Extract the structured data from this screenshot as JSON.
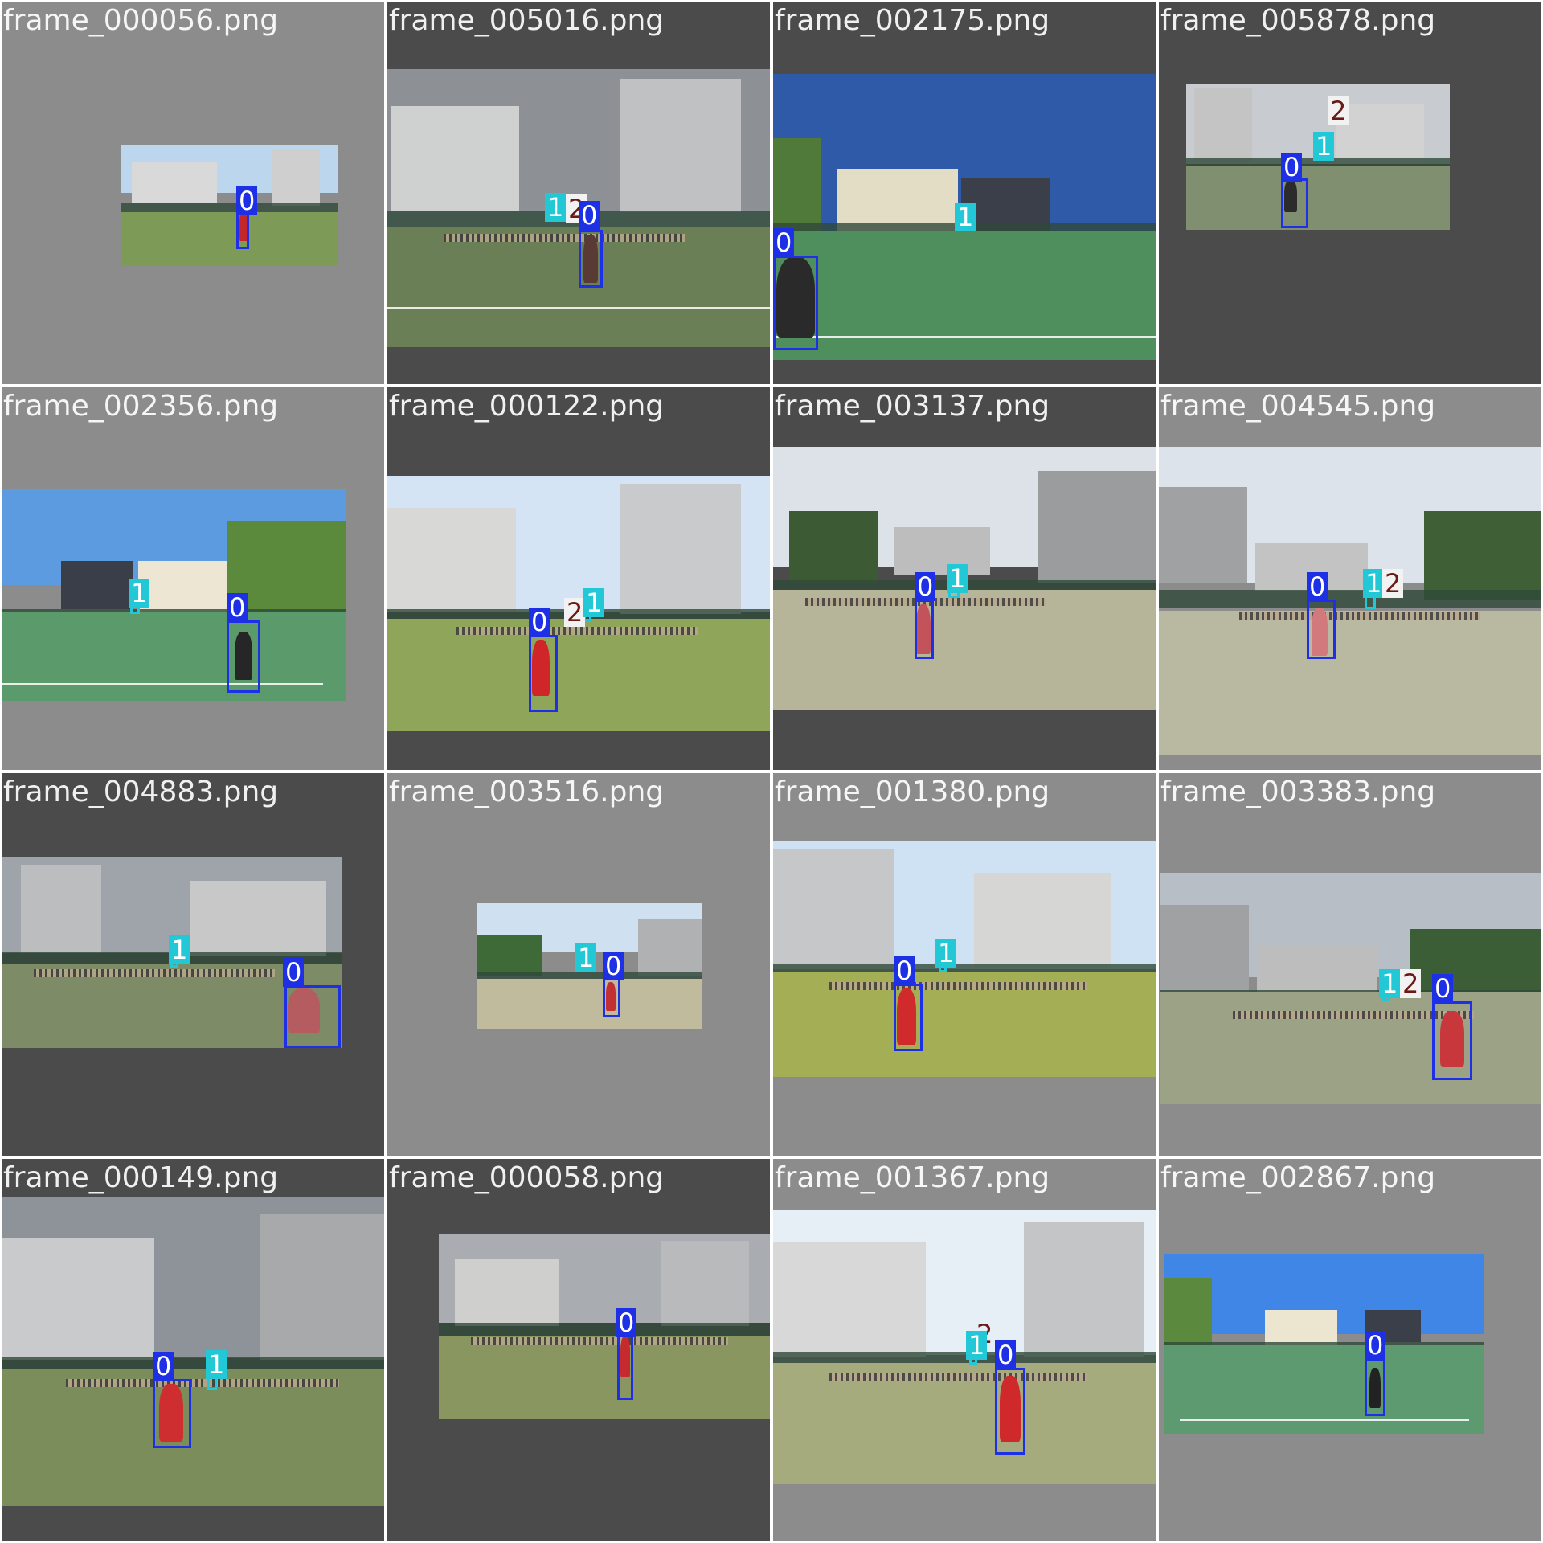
{
  "colors": {
    "tile_bg_light": "#8c8c8c",
    "tile_bg_dark": "#4b4b4b",
    "class_0": "#1e30e6",
    "class_1": "#22c8d6",
    "class_2": "#f2f2f2",
    "class_2_text": "#6a1a14"
  },
  "tiles": [
    {
      "filename": "frame_000056.png",
      "bg": "light",
      "sky": "#bcd6ee",
      "labels": [
        "0"
      ]
    },
    {
      "filename": "frame_005016.png",
      "bg": "dark",
      "sky": "#8d9196",
      "labels": [
        "1",
        "2",
        "0"
      ]
    },
    {
      "filename": "frame_002175.png",
      "bg": "dark",
      "sky": "#2f5aa8",
      "labels": [
        "0",
        "1"
      ]
    },
    {
      "filename": "frame_005878.png",
      "bg": "dark",
      "sky": "#c8ccd0",
      "labels": [
        "2",
        "1",
        "0"
      ]
    },
    {
      "filename": "frame_002356.png",
      "bg": "light",
      "sky": "#5c9be0",
      "labels": [
        "1",
        "0"
      ]
    },
    {
      "filename": "frame_000122.png",
      "bg": "dark",
      "sky": "#d4e4f4",
      "labels": [
        "2",
        "1",
        "0"
      ]
    },
    {
      "filename": "frame_003137.png",
      "bg": "dark",
      "sky": "#dde2e8",
      "labels": [
        "0",
        "1"
      ]
    },
    {
      "filename": "frame_004545.png",
      "bg": "light",
      "sky": "#dde3ea",
      "labels": [
        "0",
        "1",
        "2"
      ]
    },
    {
      "filename": "frame_004883.png",
      "bg": "dark",
      "sky": "#9fa4aa",
      "labels": [
        "1",
        "0"
      ]
    },
    {
      "filename": "frame_003516.png",
      "bg": "light",
      "sky": "#cfe0f0",
      "labels": [
        "1",
        "0"
      ]
    },
    {
      "filename": "frame_001380.png",
      "bg": "light",
      "sky": "#cfe2f4",
      "labels": [
        "0",
        "1"
      ]
    },
    {
      "filename": "frame_003383.png",
      "bg": "light",
      "sky": "#b7bec6",
      "labels": [
        "1",
        "2",
        "0"
      ]
    },
    {
      "filename": "frame_000149.png",
      "bg": "dark",
      "sky": "#8e9399",
      "labels": [
        "0",
        "1"
      ]
    },
    {
      "filename": "frame_000058.png",
      "bg": "dark",
      "sky": "#a9adb2",
      "labels": [
        "0"
      ]
    },
    {
      "filename": "frame_001367.png",
      "bg": "light",
      "sky": "#e6eef6",
      "labels": [
        "2",
        "1",
        "0"
      ]
    },
    {
      "filename": "frame_002867.png",
      "bg": "light",
      "sky": "#3f86e6",
      "labels": [
        "0"
      ]
    }
  ]
}
